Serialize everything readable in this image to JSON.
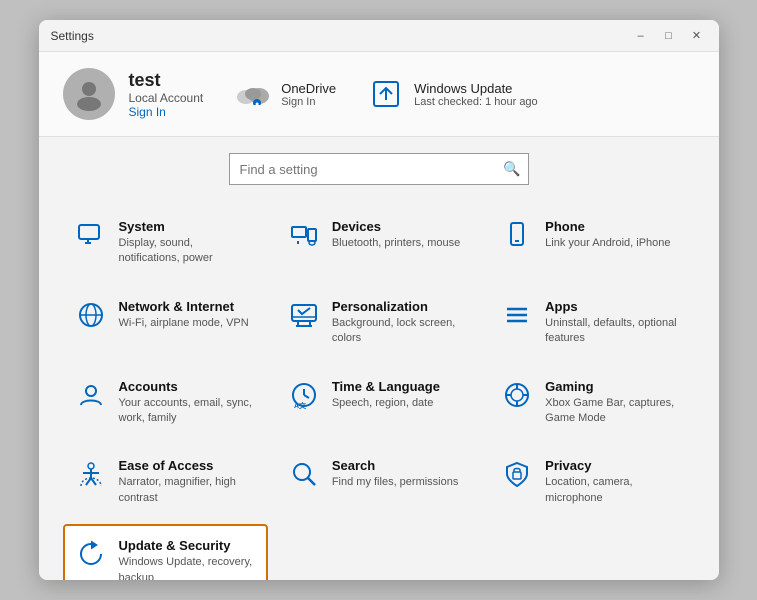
{
  "window": {
    "title": "Settings",
    "controls": {
      "minimize": "–",
      "maximize": "□",
      "close": "✕"
    }
  },
  "profile": {
    "name": "test",
    "account_type": "Local Account",
    "signin_label": "Sign In"
  },
  "services": [
    {
      "id": "onedrive",
      "name": "OneDrive",
      "sub": "Sign In"
    },
    {
      "id": "windows-update",
      "name": "Windows Update",
      "sub": "Last checked: 1 hour ago"
    }
  ],
  "search": {
    "placeholder": "Find a setting"
  },
  "settings_items": [
    {
      "id": "system",
      "title": "System",
      "desc": "Display, sound, notifications, power",
      "icon": "system"
    },
    {
      "id": "devices",
      "title": "Devices",
      "desc": "Bluetooth, printers, mouse",
      "icon": "devices"
    },
    {
      "id": "phone",
      "title": "Phone",
      "desc": "Link your Android, iPhone",
      "icon": "phone"
    },
    {
      "id": "network",
      "title": "Network & Internet",
      "desc": "Wi-Fi, airplane mode, VPN",
      "icon": "network"
    },
    {
      "id": "personalization",
      "title": "Personalization",
      "desc": "Background, lock screen, colors",
      "icon": "personalization"
    },
    {
      "id": "apps",
      "title": "Apps",
      "desc": "Uninstall, defaults, optional features",
      "icon": "apps"
    },
    {
      "id": "accounts",
      "title": "Accounts",
      "desc": "Your accounts, email, sync, work, family",
      "icon": "accounts"
    },
    {
      "id": "time",
      "title": "Time & Language",
      "desc": "Speech, region, date",
      "icon": "time"
    },
    {
      "id": "gaming",
      "title": "Gaming",
      "desc": "Xbox Game Bar, captures, Game Mode",
      "icon": "gaming"
    },
    {
      "id": "ease",
      "title": "Ease of Access",
      "desc": "Narrator, magnifier, high contrast",
      "icon": "ease"
    },
    {
      "id": "search",
      "title": "Search",
      "desc": "Find my files, permissions",
      "icon": "search"
    },
    {
      "id": "privacy",
      "title": "Privacy",
      "desc": "Location, camera, microphone",
      "icon": "privacy"
    },
    {
      "id": "update",
      "title": "Update & Security",
      "desc": "Windows Update, recovery, backup",
      "icon": "update",
      "active": true
    }
  ],
  "colors": {
    "accent": "#0067c0",
    "active_border": "#d17000"
  }
}
